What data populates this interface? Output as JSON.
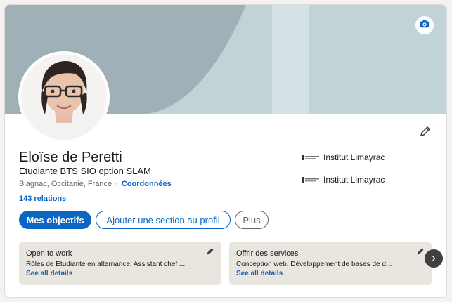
{
  "profile": {
    "name": "Eloïse de Peretti",
    "headline": "Etudiante BTS SIO option SLAM",
    "location": "Blagnac, Occitanie, France",
    "separator": "·",
    "contact_link": "Coordonnées",
    "relations": "143 relations"
  },
  "education": [
    {
      "logo_icon": "institut-logo-icon",
      "name": "Institut Limayrac"
    },
    {
      "logo_icon": "institut-logo-icon",
      "name": "Institut Limayrac"
    }
  ],
  "actions": {
    "primary": "Mes objectifs",
    "add_section": "Ajouter une section au profil",
    "more": "Plus"
  },
  "highlights": [
    {
      "title": "Open to work",
      "description": "Rôles de Étudiante en alternance, Assistant chef ...",
      "link": "See all details"
    },
    {
      "title": "Offrir des services",
      "description": "Conception web, Développement de bases de d...",
      "link": "See all details"
    }
  ],
  "icons": {
    "camera": "camera-icon",
    "edit": "pencil-icon",
    "next": "chevron-right-icon"
  },
  "colors": {
    "accent": "#0a66c2",
    "banner_light": "#c1d3d7",
    "banner_dark": "#9fb1b6",
    "tile_bg": "#e9e5df"
  }
}
